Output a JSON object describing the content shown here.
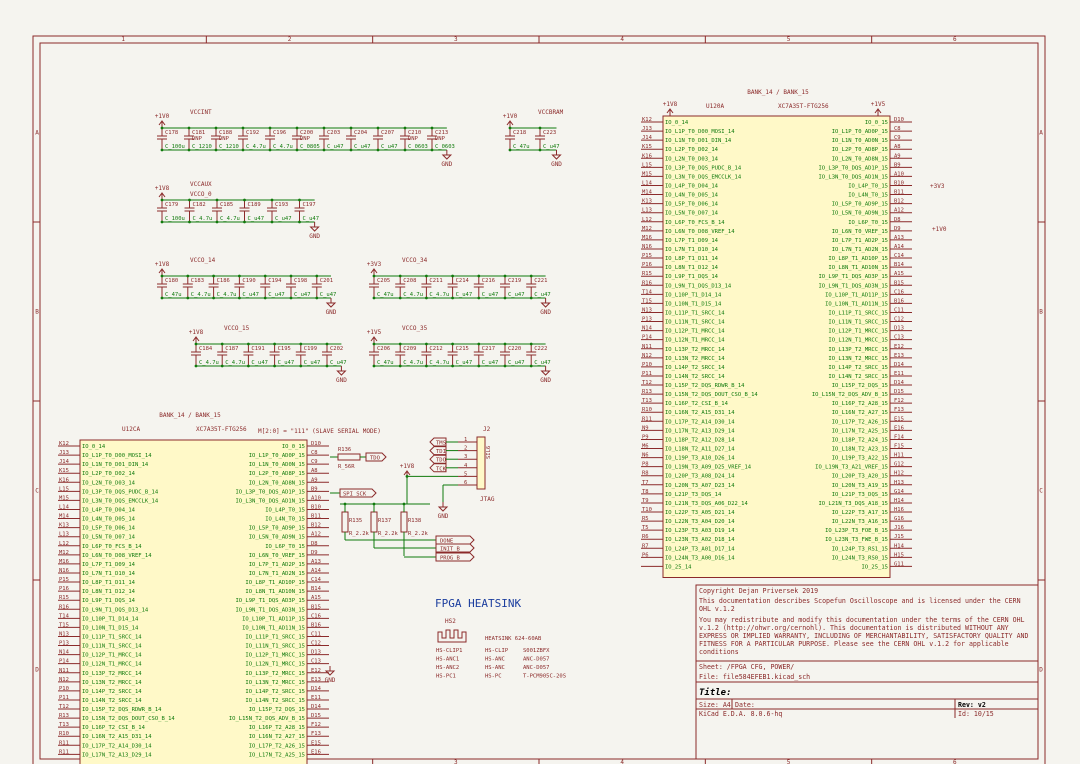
{
  "frame": {
    "columns": [
      "1",
      "2",
      "3",
      "4",
      "5",
      "6"
    ],
    "rows": [
      "A",
      "B",
      "C",
      "D"
    ]
  },
  "decoupling": {
    "vccint": {
      "power": "+1V0",
      "title": "VCCINT",
      "caps": [
        [
          "C178",
          "C_100u"
        ],
        [
          "C181",
          "DNP",
          "C_1210"
        ],
        [
          "C188",
          "DNP",
          "C_1210"
        ],
        [
          "C192",
          "C_4.7u"
        ],
        [
          "C196",
          "C_4.7u"
        ],
        [
          "C200",
          "DNP",
          "C_0805"
        ],
        [
          "C203",
          "C_u47"
        ],
        [
          "C204",
          "C_u47"
        ],
        [
          "C207",
          "C_u47"
        ],
        [
          "C210",
          "DNP",
          "C_0603"
        ],
        [
          "C213",
          "DNP",
          "C_0603"
        ]
      ]
    },
    "vccbram": {
      "power": "+1V0",
      "title": "VCCBRAM",
      "caps": [
        [
          "C218",
          "C_47u"
        ],
        [
          "C223",
          "C_u47"
        ]
      ]
    },
    "vccaux": {
      "power": "+1V8",
      "title": "VCCAUX",
      "subtitle": "VCCO_0",
      "caps": [
        [
          "C179",
          "C_100u"
        ],
        [
          "C182",
          "C_4.7u"
        ],
        [
          "C185",
          "C_4.7u"
        ],
        [
          "C189",
          "C_u47"
        ],
        [
          "C193",
          "C_u47"
        ],
        [
          "C197",
          "C_u47"
        ]
      ]
    },
    "vcco14": {
      "power": "+1V8",
      "title": "VCCO_14",
      "caps": [
        [
          "C180",
          "C_47u"
        ],
        [
          "C183",
          "C_4.7u"
        ],
        [
          "C186",
          "C_4.7u"
        ],
        [
          "C190",
          "C_u47"
        ],
        [
          "C194",
          "C_u47"
        ],
        [
          "C198",
          "C_u47"
        ],
        [
          "C201",
          "C_u47"
        ]
      ]
    },
    "vcco34": {
      "power": "+3V3",
      "title": "VCCO_34",
      "caps": [
        [
          "C205",
          "C_47u"
        ],
        [
          "C208",
          "C_4.7u"
        ],
        [
          "C211",
          "C_4.7u"
        ],
        [
          "C214",
          "C_u47"
        ],
        [
          "C216",
          "C_u47"
        ],
        [
          "C219",
          "C_u47"
        ],
        [
          "C221",
          "C_u47"
        ]
      ]
    },
    "vcco15": {
      "power": "+1V8",
      "title": "VCCO_15",
      "caps": [
        [
          "C184",
          "C_4.7u"
        ],
        [
          "C187",
          "C_4.7u"
        ],
        [
          "C191",
          "C_u47"
        ],
        [
          "C195",
          "C_u47"
        ],
        [
          "C199",
          "C_u47"
        ],
        [
          "C202",
          "C_u47"
        ]
      ]
    },
    "vcco35": {
      "power": "+1V5",
      "title": "VCCO_35",
      "caps": [
        [
          "C206",
          "C_47u"
        ],
        [
          "C209",
          "C_4.7u"
        ],
        [
          "C212",
          "C_4.7u"
        ],
        [
          "C215",
          "C_u47"
        ],
        [
          "C217",
          "C_u47"
        ],
        [
          "C220",
          "C_u47"
        ],
        [
          "C222",
          "C_u47"
        ]
      ]
    },
    "gnd": "GND"
  },
  "u120a": {
    "bank_title": "BANK_14 / BANK_15",
    "ref": "U120A",
    "part": "XC7A35T-FTG256",
    "power_left": "+1V8",
    "power_right": "+1V5",
    "left_pins": [
      [
        "K12",
        "IO_0_14"
      ],
      [
        "J13",
        "IO_L1P_T0_D00_MOSI_14"
      ],
      [
        "J14",
        "IO_L1N_T0_D01_DIN_14"
      ],
      [
        "K15",
        "IO_L2P_T0_D02_14"
      ],
      [
        "K16",
        "IO_L2N_T0_D03_14"
      ],
      [
        "L15",
        "IO_L3P_T0_DQS_PUDC_B_14"
      ],
      [
        "M15",
        "IO_L3N_T0_DQS_EMCCLK_14"
      ],
      [
        "L14",
        "IO_L4P_T0_D04_14"
      ],
      [
        "M14",
        "IO_L4N_T0_D05_14"
      ],
      [
        "K13",
        "IO_L5P_T0_D06_14"
      ],
      [
        "L13",
        "IO_L5N_T0_D07_14"
      ],
      [
        "L12",
        "IO_L6P_T0_FCS_B_14"
      ],
      [
        "M12",
        "IO_L6N_T0_D08_VREF_14"
      ],
      [
        "M16",
        "IO_L7P_T1_D09_14"
      ],
      [
        "N16",
        "IO_L7N_T1_D10_14"
      ],
      [
        "P15",
        "IO_L8P_T1_D11_14"
      ],
      [
        "P16",
        "IO_L8N_T1_D12_14"
      ],
      [
        "R15",
        "IO_L9P_T1_DQS_14"
      ],
      [
        "R16",
        "IO_L9N_T1_DQS_D13_14"
      ],
      [
        "T14",
        "IO_L10P_T1_D14_14"
      ],
      [
        "T15",
        "IO_L10N_T1_D15_14"
      ],
      [
        "N13",
        "IO_L11P_T1_SRCC_14"
      ],
      [
        "P13",
        "IO_L11N_T1_SRCC_14"
      ],
      [
        "N14",
        "IO_L12P_T1_MRCC_14"
      ],
      [
        "P14",
        "IO_L12N_T1_MRCC_14"
      ],
      [
        "N11",
        "IO_L13P_T2_MRCC_14"
      ],
      [
        "N12",
        "IO_L13N_T2_MRCC_14"
      ],
      [
        "P10",
        "IO_L14P_T2_SRCC_14"
      ],
      [
        "P11",
        "IO_L14N_T2_SRCC_14"
      ],
      [
        "T12",
        "IO_L15P_T2_DQS_RDWR_B_14"
      ],
      [
        "R13",
        "IO_L15N_T2_DQS_DOUT_CSO_B_14"
      ],
      [
        "T13",
        "IO_L16P_T2_CSI_B_14"
      ],
      [
        "R10",
        "IO_L16N_T2_A15_D31_14"
      ],
      [
        "R11",
        "IO_L17P_T2_A14_D30_14"
      ],
      [
        "N9",
        "IO_L17N_T2_A13_D29_14"
      ],
      [
        "P9",
        "IO_L18P_T2_A12_D28_14"
      ],
      [
        "M6",
        "IO_L18N_T2_A11_D27_14"
      ],
      [
        "N6",
        "IO_L19P_T3_A10_D26_14"
      ],
      [
        "P8",
        "IO_L19N_T3_A09_D25_VREF_14"
      ],
      [
        "R8",
        "IO_L20P_T3_A08_D24_14"
      ],
      [
        "T7",
        "IO_L20N_T3_A07_D23_14"
      ],
      [
        "T8",
        "IO_L21P_T3_DQS_14"
      ],
      [
        "T9",
        "IO_L21N_T3_DQS_A06_D22_14"
      ],
      [
        "T10",
        "IO_L22P_T3_A05_D21_14"
      ],
      [
        "R5",
        "IO_L22N_T3_A04_D20_14"
      ],
      [
        "T5",
        "IO_L23P_T3_A03_D19_14"
      ],
      [
        "R6",
        "IO_L23N_T3_A02_D18_14"
      ],
      [
        "R7",
        "IO_L24P_T3_A01_D17_14"
      ],
      [
        "P6",
        "IO_L24N_T3_A00_D16_14"
      ],
      [
        "",
        "IO_25_14"
      ]
    ],
    "right_pins": [
      [
        "IO_0_15",
        "D10"
      ],
      [
        "IO_L1P_T0_AD0P_15",
        "C8"
      ],
      [
        "IO_L1N_T0_AD0N_15",
        "C9"
      ],
      [
        "IO_L2P_T0_AD8P_15",
        "A8"
      ],
      [
        "IO_L2N_T0_AD8N_15",
        "A9"
      ],
      [
        "IO_L3P_T0_DQS_AD1P_15",
        "B9"
      ],
      [
        "IO_L3N_T0_DQS_AD1N_15",
        "A10"
      ],
      [
        "IO_L4P_T0_15",
        "B10"
      ],
      [
        "IO_L4N_T0_15",
        "B11"
      ],
      [
        "IO_L5P_T0_AD9P_15",
        "B12"
      ],
      [
        "IO_L5N_T0_AD9N_15",
        "A12"
      ],
      [
        "IO_L6P_T0_15",
        "D8"
      ],
      [
        "IO_L6N_T0_VREF_15",
        "D9"
      ],
      [
        "IO_L7P_T1_AD2P_15",
        "A13"
      ],
      [
        "IO_L7N_T1_AD2N_15",
        "A14"
      ],
      [
        "IO_L8P_T1_AD10P_15",
        "C14"
      ],
      [
        "IO_L8N_T1_AD10N_15",
        "B14"
      ],
      [
        "IO_L9P_T1_DQS_AD3P_15",
        "A15"
      ],
      [
        "IO_L9N_T1_DQS_AD3N_15",
        "B15"
      ],
      [
        "IO_L10P_T1_AD11P_15",
        "C16"
      ],
      [
        "IO_L10N_T1_AD11N_15",
        "B16"
      ],
      [
        "IO_L11P_T1_SRCC_15",
        "C11"
      ],
      [
        "IO_L11N_T1_SRCC_15",
        "C12"
      ],
      [
        "IO_L12P_T1_MRCC_15",
        "D13"
      ],
      [
        "IO_L12N_T1_MRCC_15",
        "C13"
      ],
      [
        "IO_L13P_T2_MRCC_15",
        "E12"
      ],
      [
        "IO_L13N_T2_MRCC_15",
        "E13"
      ],
      [
        "IO_L14P_T2_SRCC_15",
        "D14"
      ],
      [
        "IO_L14N_T2_SRCC_15",
        "E11"
      ],
      [
        "IO_L15P_T2_DQS_15",
        "D14"
      ],
      [
        "IO_L15N_T2_DQS_ADV_B_15",
        "D15"
      ],
      [
        "IO_L16P_T2_A28_15",
        "F12"
      ],
      [
        "IO_L16N_T2_A27_15",
        "F13"
      ],
      [
        "IO_L17P_T2_A26_15",
        "E15"
      ],
      [
        "IO_L17N_T2_A25_15",
        "E16"
      ],
      [
        "IO_L18P_T2_A24_15",
        "F14"
      ],
      [
        "IO_L18N_T2_A23_15",
        "F15"
      ],
      [
        "IO_L19P_T3_A22_15",
        "H11"
      ],
      [
        "IO_L19N_T3_A21_VREF_15",
        "G12"
      ],
      [
        "IO_L20P_T3_A20_15",
        "H12"
      ],
      [
        "IO_L20N_T3_A19_15",
        "H13"
      ],
      [
        "IO_L21P_T3_DQS_15",
        "G14"
      ],
      [
        "IO_L21N_T3_DQS_A18_15",
        "H14"
      ],
      [
        "IO_L22P_T3_A17_15",
        "H16"
      ],
      [
        "IO_L22N_T3_A16_15",
        "G16"
      ],
      [
        "IO_L23P_T3_FOE_B_15",
        "J16"
      ],
      [
        "IO_L23N_T3_FWE_B_15",
        "J15"
      ],
      [
        "IO_L24P_T3_RS1_15",
        "H14"
      ],
      [
        "IO_L24N_T3_RS0_15",
        "H15"
      ],
      [
        "IO_25_15",
        "G11"
      ]
    ],
    "net_3v3": "+3V3",
    "net_1v0": "+1V0"
  },
  "u12ca": {
    "bank_title": "BANK_14 / BANK_15",
    "ref": "U12CA",
    "part": "XC7A35T-FTG256",
    "mode_text": "M[2:0] = \"111\" (SLAVE SERIAL MODE)",
    "left_pins": [
      [
        "K12",
        "IO_0_14"
      ],
      [
        "J13",
        "IO_L1P_T0_D00_MOSI_14"
      ],
      [
        "J14",
        "IO_L1N_T0_D01_DIN_14"
      ],
      [
        "K15",
        "IO_L2P_T0_D02_14"
      ],
      [
        "K16",
        "IO_L2N_T0_D03_14"
      ],
      [
        "L15",
        "IO_L3P_T0_DQS_PUDC_B_14"
      ],
      [
        "M15",
        "IO_L3N_T0_DQS_EMCCLK_14"
      ],
      [
        "L14",
        "IO_L4P_T0_D04_14"
      ],
      [
        "M14",
        "IO_L4N_T0_D05_14"
      ],
      [
        "K13",
        "IO_L5P_T0_D06_14"
      ],
      [
        "L13",
        "IO_L5N_T0_D07_14"
      ],
      [
        "L12",
        "IO_L6P_T0_FCS_B_14"
      ],
      [
        "M12",
        "IO_L6N_T0_D08_VREF_14"
      ],
      [
        "M16",
        "IO_L7P_T1_D09_14"
      ],
      [
        "N16",
        "IO_L7N_T1_D10_14"
      ],
      [
        "P15",
        "IO_L8P_T1_D11_14"
      ],
      [
        "P16",
        "IO_L8N_T1_D12_14"
      ],
      [
        "R15",
        "IO_L9P_T1_DQS_14"
      ],
      [
        "R16",
        "IO_L9N_T1_DQS_D13_14"
      ],
      [
        "T14",
        "IO_L10P_T1_D14_14"
      ],
      [
        "T15",
        "IO_L10N_T1_D15_14"
      ],
      [
        "N13",
        "IO_L11P_T1_SRCC_14"
      ],
      [
        "P13",
        "IO_L11N_T1_SRCC_14"
      ],
      [
        "N14",
        "IO_L12P_T1_MRCC_14"
      ],
      [
        "P14",
        "IO_L12N_T1_MRCC_14"
      ],
      [
        "N11",
        "IO_L13P_T2_MRCC_14"
      ],
      [
        "N12",
        "IO_L13N_T2_MRCC_14"
      ],
      [
        "P10",
        "IO_L14P_T2_SRCC_14"
      ],
      [
        "P11",
        "IO_L14N_T2_SRCC_14"
      ],
      [
        "T12",
        "IO_L15P_T2_DQS_RDWR_B_14"
      ],
      [
        "R13",
        "IO_L15N_T2_DQS_DOUT_CSO_B_14"
      ],
      [
        "T13",
        "IO_L16P_T2_CSI_B_14"
      ],
      [
        "R10",
        "IO_L16N_T2_A15_D31_14"
      ],
      [
        "R11",
        "IO_L17P_T2_A14_D30_14"
      ],
      [
        "R11",
        "IO_L17N_T2_A13_D29_14"
      ]
    ],
    "right_pins": [
      [
        "IO_0_15",
        "D10"
      ],
      [
        "IO_L1P_T0_AD0P_15",
        "C8"
      ],
      [
        "IO_L1N_T0_AD0N_15",
        "C9"
      ],
      [
        "IO_L2P_T0_AD8P_15",
        "A8"
      ],
      [
        "IO_L2N_T0_AD8N_15",
        "A9"
      ],
      [
        "IO_L3P_T0_DQS_AD1P_15",
        "B9"
      ],
      [
        "IO_L3N_T0_DQS_AD1N_15",
        "A10"
      ],
      [
        "IO_L4P_T0_15",
        "B10"
      ],
      [
        "IO_L4N_T0_15",
        "B11"
      ],
      [
        "IO_L5P_T0_AD9P_15",
        "B12"
      ],
      [
        "IO_L5N_T0_AD9N_15",
        "A12"
      ],
      [
        "IO_L6P_T0_15",
        "D8"
      ],
      [
        "IO_L6N_T0_VREF_15",
        "D9"
      ],
      [
        "IO_L7P_T1_AD2P_15",
        "A13"
      ],
      [
        "IO_L7N_T1_AD2N_15",
        "A14"
      ],
      [
        "IO_L8P_T1_AD10P_15",
        "C14"
      ],
      [
        "IO_L8N_T1_AD10N_15",
        "B14"
      ],
      [
        "IO_L9P_T1_DQS_AD3P_15",
        "A15"
      ],
      [
        "IO_L9N_T1_DQS_AD3N_15",
        "B15"
      ],
      [
        "IO_L10P_T1_AD11P_15",
        "C16"
      ],
      [
        "IO_L10N_T1_AD11N_15",
        "B16"
      ],
      [
        "IO_L11P_T1_SRCC_15",
        "C11"
      ],
      [
        "IO_L11N_T1_SRCC_15",
        "C12"
      ],
      [
        "IO_L12P_T1_MRCC_15",
        "D13"
      ],
      [
        "IO_L12N_T1_MRCC_15",
        "C13"
      ],
      [
        "IO_L13P_T2_MRCC_15",
        "E12"
      ],
      [
        "IO_L13N_T2_MRCC_15",
        "E13"
      ],
      [
        "IO_L14P_T2_SRCC_15",
        "D14"
      ],
      [
        "IO_L14N_T2_SRCC_15",
        "E11"
      ],
      [
        "IO_L15P_T2_DQS_15",
        "D14"
      ],
      [
        "IO_L15N_T2_DQS_ADV_B_15",
        "D15"
      ],
      [
        "IO_L16P_T2_A28_15",
        "F12"
      ],
      [
        "IO_L16N_T2_A27_15",
        "F13"
      ],
      [
        "IO_L17P_T2_A26_15",
        "E15"
      ],
      [
        "IO_L17N_T2_A25_15",
        "E16"
      ]
    ]
  },
  "config": {
    "r136": {
      "ref": "R136",
      "val": "R_56R"
    },
    "r135": {
      "ref": "R135",
      "val": "R_2.2k"
    },
    "r137": {
      "ref": "R137",
      "val": "R_2.2k"
    },
    "r138": {
      "ref": "R138",
      "val": "R_2.2k"
    },
    "labels": {
      "tdo": "TDO",
      "spi_sck": "SPI_SCK",
      "done": "DONE",
      "init_b": "INIT_B",
      "prog_b": "PROG_B"
    },
    "power": "+1V8",
    "gnd": "GND",
    "gnd2": "GND"
  },
  "jtag": {
    "ref": "J2",
    "name": "JTAG",
    "type": "SIL6",
    "signals": [
      "TMS",
      "TDI",
      "TDO",
      "TCK"
    ],
    "pins": [
      "1",
      "2",
      "3",
      "4",
      "5",
      "6"
    ]
  },
  "heatsink": {
    "title": "FPGA HEATSINK",
    "ref": "HS2",
    "part": "HEATSINK 624-60AB",
    "rows": [
      [
        "HS-CLIP1",
        "HS-CLIP",
        "S001ZBFX"
      ],
      [
        "HS-ANC1",
        "HS-ANC",
        "ANC-D057"
      ],
      [
        "HS-ANC2",
        "HS-ANC",
        "ANC-D057"
      ],
      [
        "HS-PC1",
        "HS-PC",
        "T-PCM905C-20S"
      ]
    ]
  },
  "titleblock": {
    "copyright": "Copyright Dejan Priversek 2019",
    "lic1": "This documentation describes Scopefun Oscilloscope and is licensed under the CERN OHL v.1.2",
    "lic2": "You may redistribute and modify this documentation under the terms of the CERN OHL v.1.2 (http://ohwr.org/cernohl). This documentation is distributed WITHOUT ANY EXPRESS OR IMPLIED WARRANTY, INCLUDING OF MERCHANTABILITY, SATISFACTORY QUALITY AND FITNESS FOR A PARTICULAR PURPOSE. Please see the CERN OHL v.1.2 for applicable conditions",
    "sheet": "Sheet: /FPGA CFG, POWER/",
    "file": "File: file584EFEB1.kicad_sch",
    "title_label": "Title:",
    "size": "Size: A4",
    "date": "Date:",
    "rev": "Rev: v2",
    "kicad": "KiCad E.D.A. 8.0.6-hq",
    "id": "Id: 10/15"
  }
}
